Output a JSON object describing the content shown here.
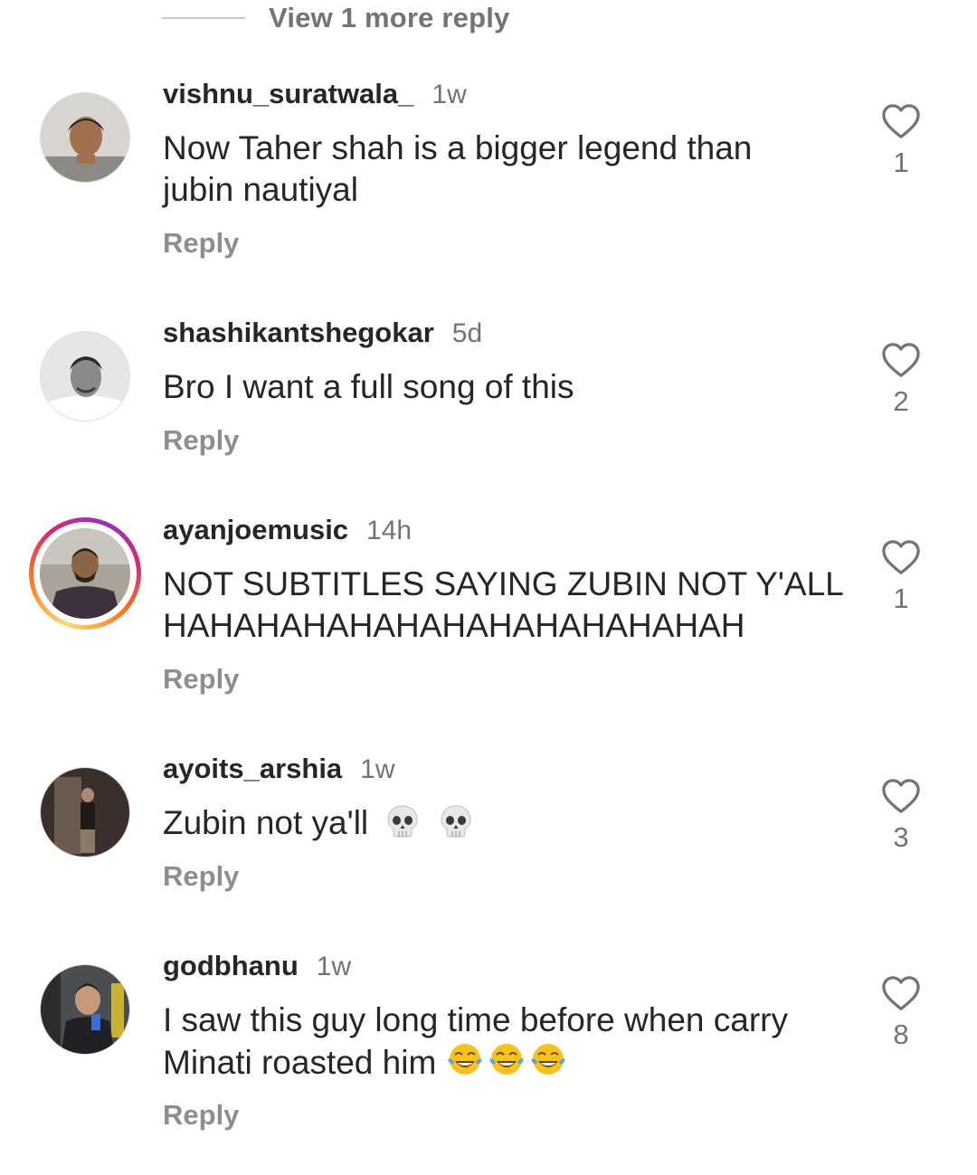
{
  "view_more": {
    "label": "View 1 more reply"
  },
  "comments": [
    {
      "username": "vishnu_suratwala_",
      "time": "1w",
      "text_line1": "Now Taher shah is a bigger legend than",
      "text_line2": "jubin nautiyal",
      "reply_label": "Reply",
      "likes": "1"
    },
    {
      "username": "shashikantshegokar",
      "time": "5d",
      "text_line1": "Bro I want a full song of this",
      "reply_label": "Reply",
      "likes": "2"
    },
    {
      "username": "ayanjoemusic",
      "time": "14h",
      "text_line1": "NOT SUBTITLES SAYING ZUBIN NOT Y'ALL",
      "text_line2": "HAHAHAHAHAHAHAHAHAHAHAHAH",
      "reply_label": "Reply",
      "likes": "1",
      "has_story": true
    },
    {
      "username": "ayoits_arshia",
      "time": "1w",
      "text_line1": "Zubin not ya'll",
      "emojis": [
        "skull",
        "skull"
      ],
      "reply_label": "Reply",
      "likes": "3"
    },
    {
      "username": "godbhanu",
      "time": "1w",
      "text_line1": "I saw this guy long time before when carry",
      "text_line2": "Minati roasted him",
      "emojis": [
        "face-with-tears-of-joy",
        "face-with-tears-of-joy",
        "face-with-tears-of-joy"
      ],
      "reply_label": "Reply",
      "likes": "8"
    }
  ],
  "icons": {
    "like": "heart-outline-icon"
  },
  "colors": {
    "text": "#262626",
    "secondary": "#737373",
    "reply": "#8e8e8e",
    "story_ring": [
      "#feda75",
      "#fa7e1e",
      "#d62976",
      "#962fbf"
    ]
  }
}
